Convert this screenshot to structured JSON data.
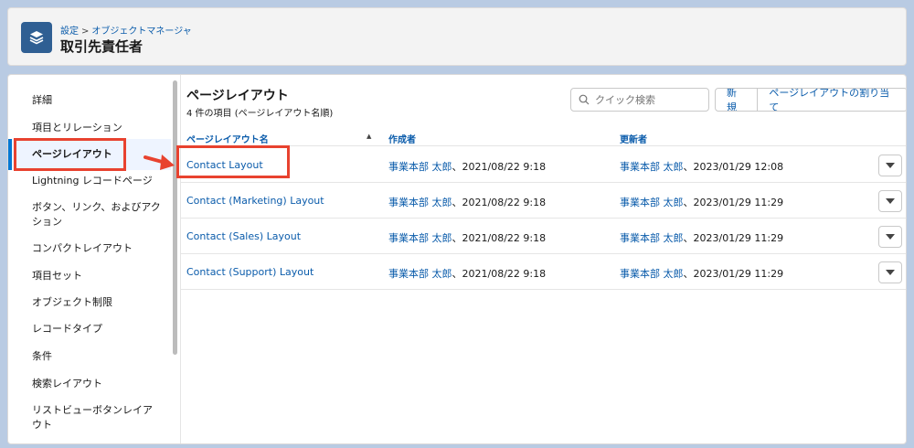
{
  "header": {
    "breadcrumb_root": "設定",
    "breadcrumb_sep": ">",
    "breadcrumb_current": "オブジェクトマネージャ",
    "title": "取引先責任者"
  },
  "sidebar": {
    "items": [
      {
        "label": "詳細"
      },
      {
        "label": "項目とリレーション"
      },
      {
        "label": "ページレイアウト"
      },
      {
        "label": "Lightning レコードページ"
      },
      {
        "label": "ボタン、リンク、およびアク"
      },
      {
        "label": "ション"
      },
      {
        "label": "コンパクトレイアウト"
      },
      {
        "label": "項目セット"
      },
      {
        "label": "オブジェクト制限"
      },
      {
        "label": "レコードタイプ"
      },
      {
        "label": "条件"
      },
      {
        "label": "検索レイアウト"
      },
      {
        "label": "リストビューボタンレイア"
      },
      {
        "label": "ウト"
      }
    ]
  },
  "content": {
    "title": "ページレイアウト",
    "subtitle": "4 件の項目 (ページレイアウト名順)",
    "search_placeholder": "クイック検索",
    "new_button": "新規",
    "assign_button": "ページレイアウトの割り当て",
    "columns": [
      "ページレイアウト名",
      "作成者",
      "更新者"
    ],
    "sort_indicator": "▲",
    "rows": [
      {
        "name": "Contact Layout",
        "created_by": "事業本部 太郎",
        "created_at": "、2021/08/22 9:18",
        "updated_by": "事業本部 太郎",
        "updated_at": "、2023/01/29 12:08"
      },
      {
        "name": "Contact (Marketing) Layout",
        "created_by": "事業本部 太郎",
        "created_at": "、2021/08/22 9:18",
        "updated_by": "事業本部 太郎",
        "updated_at": "、2023/01/29 11:29"
      },
      {
        "name": "Contact (Sales) Layout",
        "created_by": "事業本部 太郎",
        "created_at": "、2021/08/22 9:18",
        "updated_by": "事業本部 太郎",
        "updated_at": "、2023/01/29 11:29"
      },
      {
        "name": "Contact (Support) Layout",
        "created_by": "事業本部 太郎",
        "created_at": "、2021/08/22 9:18",
        "updated_by": "事業本部 太郎",
        "updated_at": "、2023/01/29 11:29"
      }
    ]
  },
  "colors": {
    "accent": "#0b5cab",
    "annotation": "#e8422f",
    "icon_bg": "#2f5f93"
  }
}
